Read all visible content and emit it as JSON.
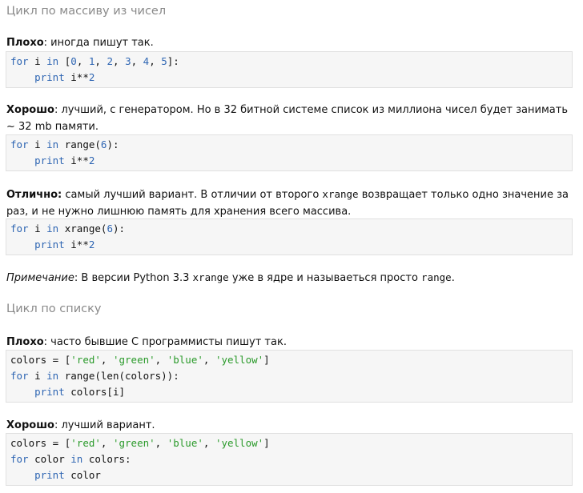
{
  "sections": [
    {
      "title": "Цикл по массиву из чисел"
    },
    {
      "title": "Цикл по списку"
    }
  ],
  "blocks": [
    {
      "label": "Плохо",
      "text": ": иногда пишут так."
    },
    {
      "label": "Хорошо",
      "text": ": лучший, с генератором. Но в 32 битной системе список из миллиона чисел будет занимать ~ 32 mb памяти."
    },
    {
      "label": "Отлично:",
      "text_before": " самый лучший вариант. В отличии от второго ",
      "code_word": "xrange",
      "text_after": " возвращает только одно значение за раз, и не нужно лишнюю память для хранения всего массива."
    },
    {
      "label": "Примечание",
      "text_before": ": В версии Python 3.3 ",
      "code_word": "xrange",
      "text_middle": " уже в ядре и называеться просто ",
      "code_word2": "range",
      "text_after": "."
    },
    {
      "label": "Плохо",
      "text": ": часто бывшие С программисты пишут так."
    },
    {
      "label": "Хорошо",
      "text": ": лучший вариант."
    }
  ],
  "code": {
    "c1": {
      "for": "for",
      "i": " i ",
      "in": "in",
      "open": " [",
      "n0": "0",
      "n1": "1",
      "n2": "2",
      "n3": "3",
      "n4": "4",
      "n5": "5",
      "sep": ", ",
      "close": "]:",
      "print": "print",
      "expr": " i**",
      "exp": "2",
      "indent": "    "
    },
    "c2": {
      "for": "for",
      "i": " i ",
      "in": "in",
      "call": " range(",
      "arg": "6",
      "close": "):",
      "print": "print",
      "expr": " i**",
      "exp": "2",
      "indent": "    "
    },
    "c3": {
      "for": "for",
      "i": " i ",
      "in": "in",
      "call": " xrange(",
      "arg": "6",
      "close": "):",
      "print": "print",
      "expr": " i**",
      "exp": "2",
      "indent": "    "
    },
    "c4": {
      "assign": "colors = [",
      "s1": "'red'",
      "s2": "'green'",
      "s3": "'blue'",
      "s4": "'yellow'",
      "sep": ", ",
      "close": "]",
      "for": "for",
      "i": " i ",
      "in": "in",
      "rest": " range(len(colors)):",
      "print": "print",
      "expr": " colors[i]",
      "indent": "    "
    },
    "c5": {
      "assign": "colors = [",
      "s1": "'red'",
      "s2": "'green'",
      "s3": "'blue'",
      "s4": "'yellow'",
      "sep": ", ",
      "close": "]",
      "for": "for",
      "var": " color ",
      "in": "in",
      "rest": " colors:",
      "print": "print",
      "expr": " color",
      "indent": "    "
    }
  },
  "colors": {
    "keyword": "#2f66b3",
    "string": "#2a9a2a",
    "heading": "#8a8a8a"
  }
}
